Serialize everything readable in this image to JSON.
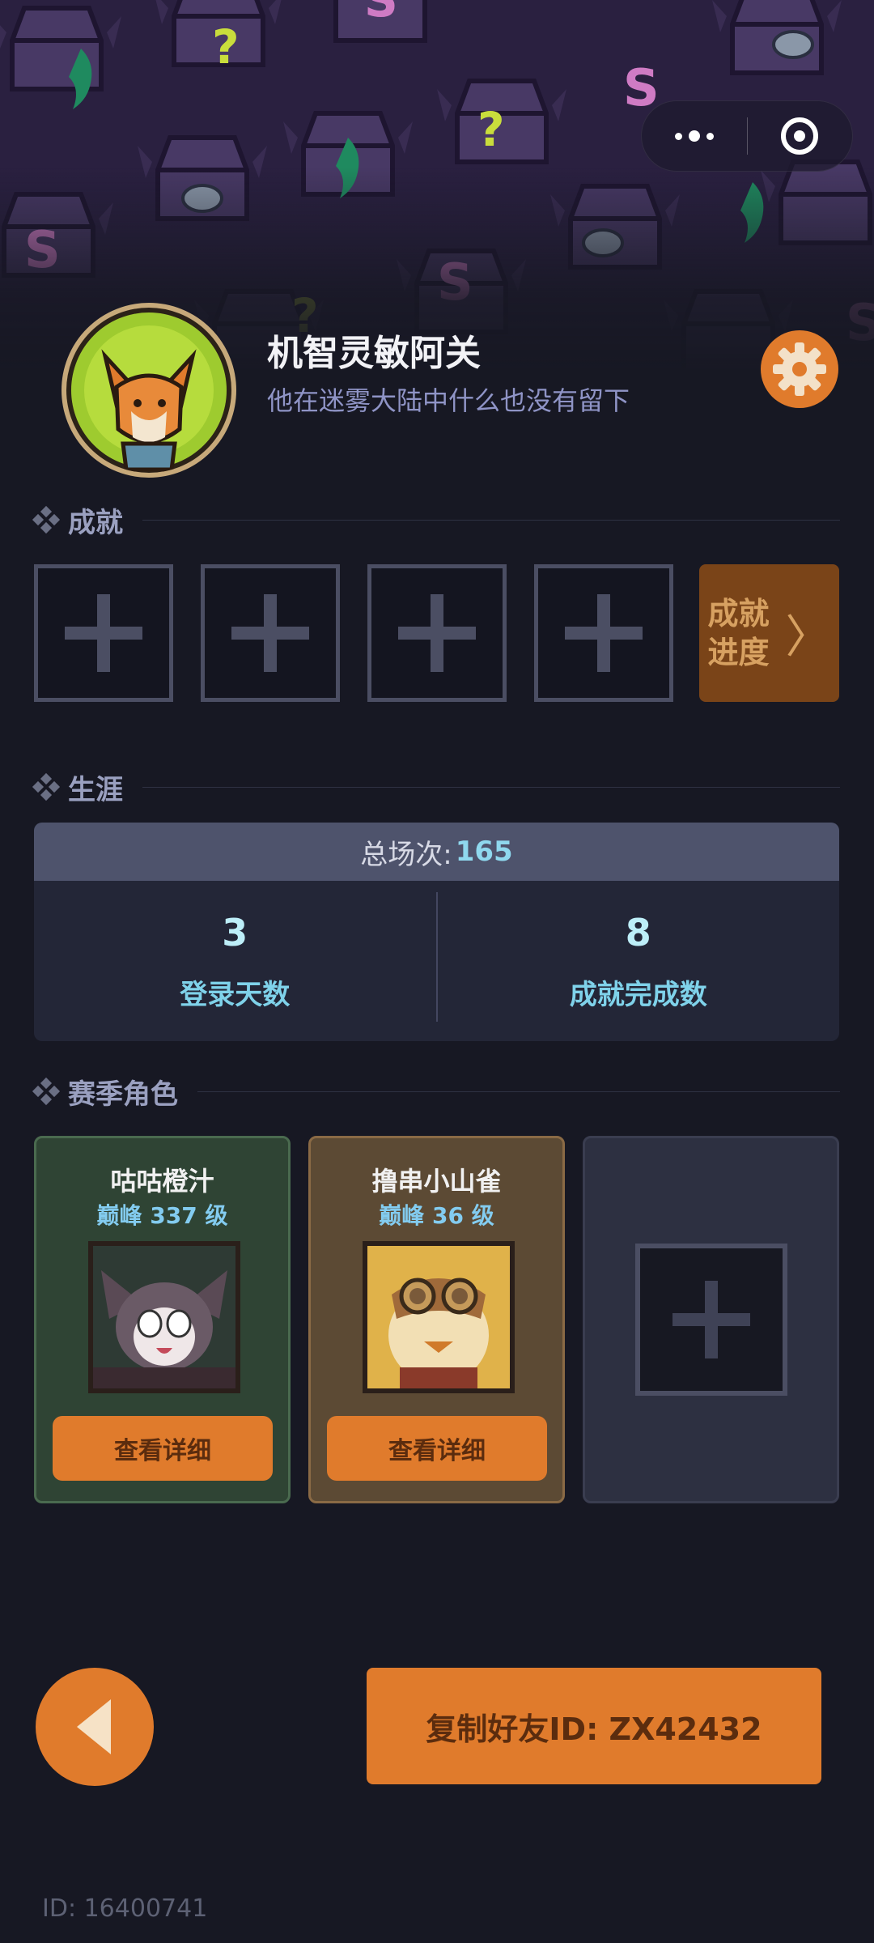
{
  "colors": {
    "background": "#171823",
    "accent_orange": "#e07b2c",
    "achievement_progress_bg": "#7a4418",
    "cyan_value": "#8fd8ee",
    "muted_purple": "#8f94c6"
  },
  "header": {
    "capsule": {
      "menu_icon": "more-dots-icon",
      "close_icon": "target-circle-icon"
    }
  },
  "profile": {
    "avatar_icon": "fox-avatar-icon",
    "name": "机智灵敏阿关",
    "motto": "他在迷雾大陆中什么也没有留下",
    "settings_icon": "gear-icon"
  },
  "achievements": {
    "section_title": "成就",
    "slots": [
      "empty",
      "empty",
      "empty",
      "empty"
    ],
    "progress_label": "成就进度",
    "progress_label_line1": "成就",
    "progress_label_line2": "进度",
    "progress_chevron": "〉"
  },
  "career": {
    "section_title": "生涯",
    "total_label": "总场次:",
    "total_value": "165",
    "stats": [
      {
        "value": "3",
        "label": "登录天数"
      },
      {
        "value": "8",
        "label": "成就完成数"
      }
    ]
  },
  "season": {
    "section_title": "赛季角色",
    "cards": [
      {
        "name": "咕咕橙汁",
        "level": "巅峰 337 级",
        "button": "查看详细"
      },
      {
        "name": "撸串小山雀",
        "level": "巅峰 36 级",
        "button": "查看详细"
      }
    ]
  },
  "footer": {
    "back_icon": "back-arrow-icon",
    "copy_button": "复制好友ID: ZX42432",
    "uid": "ID: 16400741"
  }
}
